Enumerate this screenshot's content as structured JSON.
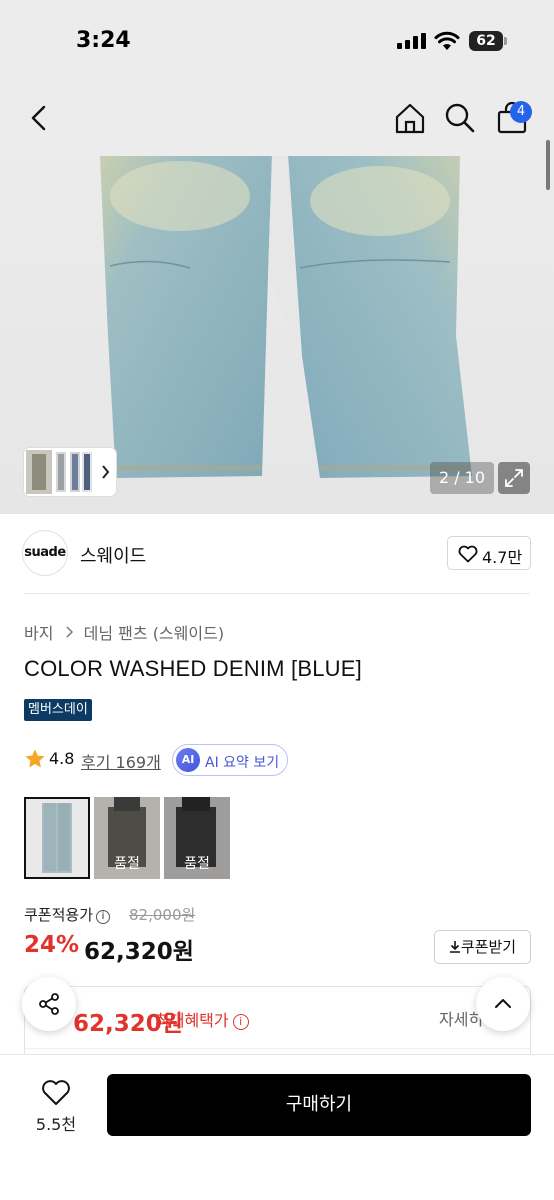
{
  "status": {
    "time": "3:24",
    "battery": "62"
  },
  "nav": {
    "cart_count": "4"
  },
  "gallery": {
    "counter": "2 / 10"
  },
  "brand": {
    "logo_text": "suade",
    "name": "스웨이드",
    "likes": "4.7만"
  },
  "breadcrumb": [
    "바지",
    "데님 팬츠 (스웨이드)"
  ],
  "product": {
    "title": "COLOR WASHED DENIM [BLUE]",
    "tag": "멤버스데이",
    "rating": "4.8",
    "reviews": "후기 169개",
    "ai_badge": "AI",
    "ai_summary": "AI 요약 보기"
  },
  "options": [
    {
      "status": ""
    },
    {
      "status": "품절"
    },
    {
      "status": "품절"
    }
  ],
  "pricing": {
    "coupon_label": "쿠폰적용가",
    "original": "82,000원",
    "discount": "24%",
    "price": "62,320원",
    "coupon_button": "쿠폰받기"
  },
  "benefit": {
    "price": "62,320원",
    "label": "최대혜택가",
    "detail": "자세히"
  },
  "bottom": {
    "wish_count": "5.5천",
    "buy_label": "구매하기"
  },
  "colors": {
    "accent_red": "#e0332c",
    "badge_blue": "#2563eb",
    "tag_navy": "#0d3a63"
  }
}
